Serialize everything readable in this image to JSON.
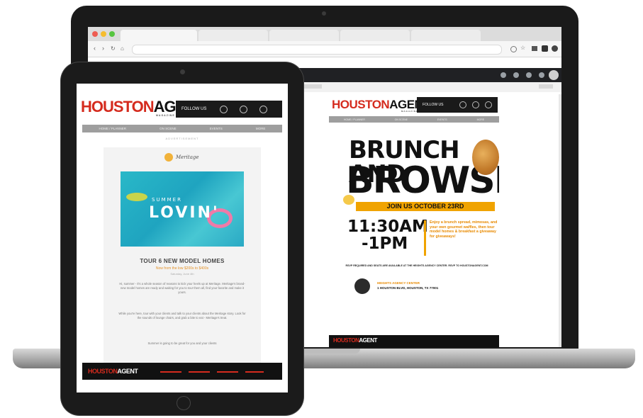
{
  "laptop": {
    "tabs": [
      "",
      "",
      "",
      "",
      ""
    ],
    "email": {
      "logo_houston": "HOUSTON",
      "logo_agent": "AGENT",
      "logo_sub": "MAGAZINE",
      "follow_label": "FOLLOW US",
      "nav": [
        "HOME / PLANNER",
        "ON SCENE",
        "EVENTS",
        "MORE"
      ],
      "ad": {
        "line1": "BRUNCH AND",
        "line2": "BROWSE",
        "join": "JOIN US OCTOBER 23RD",
        "time1": "11:30AM",
        "time2": "-1PM",
        "promo": "Enjoy a brunch spread, mimosas, and your own gourmet waffles, then tour model homes & breakfast a giveaway for giveaways!",
        "fine": "RSVP REQUIRED AND SEATS ARE AVAILABLE AT THE HEIGHTS AGENCY CENTER. RSVP TO HOUSTONAGENT.COM",
        "venue_name": "HEIGHTS AGENCY CENTER",
        "venue_addr": "1 HOUSTON BLVD, HOUSTON, TX 77001"
      }
    }
  },
  "tablet": {
    "email": {
      "logo_houston": "HOUSTON",
      "logo_agent": "AGENT",
      "logo_sub": "MAGAZINE",
      "follow_label": "FOLLOW US",
      "nav": [
        "HOME / PLANNER",
        "ON SCENE",
        "EVENTS",
        "MORE"
      ],
      "advertisement": "ADVERTISEMENT",
      "brand": "Meritage",
      "summer": "SUMMER",
      "lovin": "LOVIN'",
      "headline": "TOUR 6 NEW  MODEL HOMES",
      "subhead": "Now from the low $200s to $400s",
      "date": "Saturday, June 4th",
      "para1": "Hi, summer - it's a whole season of reasons to kick your heels up at Meritage. Meritage's brand-new model homes are ready and waiting for you to tour them all, find your favorite and make it yours.",
      "para2": "While you're here, tour with your clients and talk to your clients about the Meritage story. Look for the sounds of lounge chairs, and grab a bite to eat - Meritage's treat.",
      "para3": "Summer is going to be great for you and your clients"
    }
  }
}
